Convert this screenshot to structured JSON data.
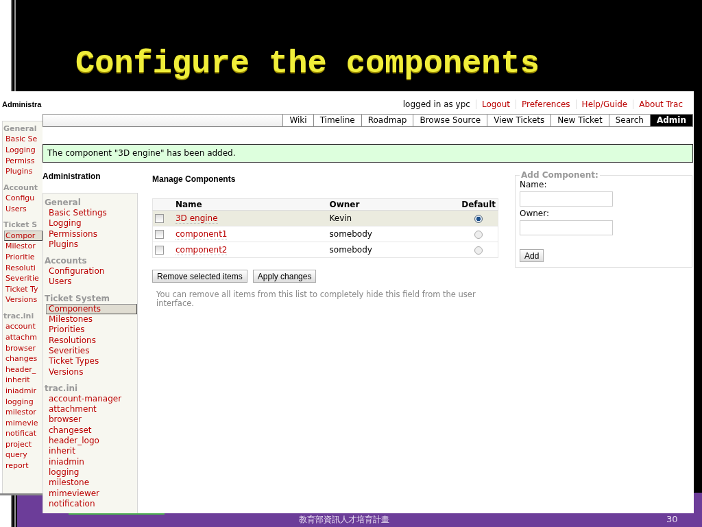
{
  "slide": {
    "title": "Configure the components",
    "footer": "教育部資訊人才培育計畫",
    "page_number": "30"
  },
  "back_window": {
    "heading": "Administra",
    "sections": [
      {
        "title": "General",
        "items": [
          {
            "label": "Basic Se",
            "selected": false
          },
          {
            "label": "Logging",
            "selected": false
          },
          {
            "label": "Permiss",
            "selected": false
          },
          {
            "label": "Plugins",
            "selected": false
          }
        ]
      },
      {
        "title": "Account",
        "items": [
          {
            "label": "Configu",
            "selected": false
          },
          {
            "label": "Users",
            "selected": false
          }
        ]
      },
      {
        "title": "Ticket S",
        "items": [
          {
            "label": "Compor",
            "selected": true
          },
          {
            "label": "Milestor",
            "selected": false
          },
          {
            "label": "Prioritie",
            "selected": false
          },
          {
            "label": "Resoluti",
            "selected": false
          },
          {
            "label": "Severitie",
            "selected": false
          },
          {
            "label": "Ticket Ty",
            "selected": false
          },
          {
            "label": "Versions",
            "selected": false
          }
        ]
      },
      {
        "title": "trac.ini",
        "items": [
          {
            "label": "account",
            "selected": false
          },
          {
            "label": "attachm",
            "selected": false
          },
          {
            "label": "browser",
            "selected": false
          },
          {
            "label": "changes",
            "selected": false
          },
          {
            "label": "header_",
            "selected": false
          },
          {
            "label": "inherit",
            "selected": false
          },
          {
            "label": "iniadmir",
            "selected": false
          },
          {
            "label": "logging",
            "selected": false
          },
          {
            "label": "milestor",
            "selected": false
          },
          {
            "label": "mimevie",
            "selected": false
          },
          {
            "label": "notificat",
            "selected": false
          },
          {
            "label": "project",
            "selected": false
          },
          {
            "label": "query",
            "selected": false
          },
          {
            "label": "report",
            "selected": false
          }
        ]
      }
    ]
  },
  "window": {
    "meta_nav": {
      "user": "logged in as ypc",
      "links": [
        "Logout",
        "Preferences",
        "Help/Guide",
        "About Trac"
      ]
    },
    "main_nav": [
      {
        "label": "Wiki",
        "selected": false
      },
      {
        "label": "Timeline",
        "selected": false
      },
      {
        "label": "Roadmap",
        "selected": false
      },
      {
        "label": "Browse Source",
        "selected": false
      },
      {
        "label": "View Tickets",
        "selected": false
      },
      {
        "label": "New Ticket",
        "selected": false
      },
      {
        "label": "Search",
        "selected": false
      },
      {
        "label": "Admin",
        "selected": true
      }
    ],
    "notice": "The component \"3D engine\" has been added.",
    "sidebar": {
      "heading": "Administration",
      "sections": [
        {
          "title": "General",
          "items": [
            {
              "label": "Basic Settings",
              "selected": false
            },
            {
              "label": "Logging",
              "selected": false
            },
            {
              "label": "Permissions",
              "selected": false
            },
            {
              "label": "Plugins",
              "selected": false
            }
          ]
        },
        {
          "title": "Accounts",
          "items": [
            {
              "label": "Configuration",
              "selected": false
            },
            {
              "label": "Users",
              "selected": false
            }
          ]
        },
        {
          "title": "Ticket System",
          "items": [
            {
              "label": "Components",
              "selected": true
            },
            {
              "label": "Milestones",
              "selected": false
            },
            {
              "label": "Priorities",
              "selected": false
            },
            {
              "label": "Resolutions",
              "selected": false
            },
            {
              "label": "Severities",
              "selected": false
            },
            {
              "label": "Ticket Types",
              "selected": false
            },
            {
              "label": "Versions",
              "selected": false
            }
          ]
        },
        {
          "title": "trac.ini",
          "items": [
            {
              "label": "account-manager",
              "selected": false
            },
            {
              "label": "attachment",
              "selected": false
            },
            {
              "label": "browser",
              "selected": false
            },
            {
              "label": "changeset",
              "selected": false
            },
            {
              "label": "header_logo",
              "selected": false
            },
            {
              "label": "inherit",
              "selected": false
            },
            {
              "label": "iniadmin",
              "selected": false
            },
            {
              "label": "logging",
              "selected": false
            },
            {
              "label": "milestone",
              "selected": false
            },
            {
              "label": "mimeviewer",
              "selected": false
            },
            {
              "label": "notification",
              "selected": false
            }
          ]
        }
      ]
    },
    "content": {
      "heading": "Manage Components",
      "columns": [
        "Name",
        "Owner",
        "Default"
      ],
      "rows": [
        {
          "name": "3D engine",
          "owner": "Kevin",
          "checked": false,
          "selected": true,
          "highlighted": true
        },
        {
          "name": "component1",
          "owner": "somebody",
          "checked": false,
          "selected": false,
          "highlighted": false
        },
        {
          "name": "component2",
          "owner": "somebody",
          "checked": false,
          "selected": false,
          "highlighted": false
        }
      ],
      "buttons": [
        "Remove selected items",
        "Apply changes"
      ],
      "hint": "You can remove all items from this list to completely hide this field from the user interface."
    },
    "add_form": {
      "legend": "Add Component:",
      "fields": [
        {
          "label": "Name:"
        },
        {
          "label": "Owner:"
        }
      ],
      "button": "Add"
    }
  }
}
